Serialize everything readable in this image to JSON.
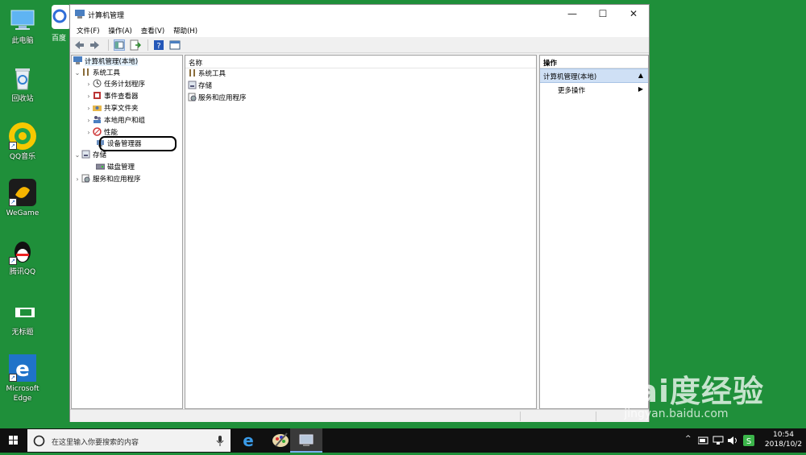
{
  "desktop": {
    "icons": [
      {
        "label": "此电脑",
        "icon": "computer-icon"
      },
      {
        "label": "回收站",
        "icon": "recycle-bin-icon"
      },
      {
        "label": "QQ音乐",
        "icon": "qq-music-icon"
      },
      {
        "label": "WeGame",
        "icon": "wegame-icon"
      },
      {
        "label": "腾讯QQ",
        "icon": "qq-penguin-icon"
      },
      {
        "label": "无标题",
        "icon": "file-icon"
      },
      {
        "label": "Microsoft Edge",
        "icon": "edge-icon"
      }
    ],
    "partial_icon_label": "百度"
  },
  "window": {
    "title": "计算机管理",
    "controls": {
      "minimize": "—",
      "maximize": "☐",
      "close": "✕"
    },
    "menu": [
      "文件(F)",
      "操作(A)",
      "查看(V)",
      "帮助(H)"
    ]
  },
  "tree": {
    "root": "计算机管理(本地)",
    "system_tools": "系统工具",
    "children": [
      "任务计划程序",
      "事件查看器",
      "共享文件夹",
      "本地用户和组",
      "性能",
      "设备管理器"
    ],
    "storage": "存储",
    "disk_mgmt": "磁盘管理",
    "services": "服务和应用程序"
  },
  "list": {
    "column": "名称",
    "rows": [
      "系统工具",
      "存储",
      "服务和应用程序"
    ]
  },
  "actions": {
    "header": "操作",
    "selected": "计算机管理(本地)",
    "more": "更多操作"
  },
  "taskbar": {
    "search_placeholder": "在这里输入你要搜索的内容",
    "time": "10:54",
    "date": "2018/10/2"
  },
  "watermark": {
    "brand": "Bai度经验",
    "url": "jingyan.baidu.com"
  },
  "colors": {
    "desktop": "#1f8f3a",
    "taskbar": "#101010",
    "selection": "#cfe0f5"
  }
}
